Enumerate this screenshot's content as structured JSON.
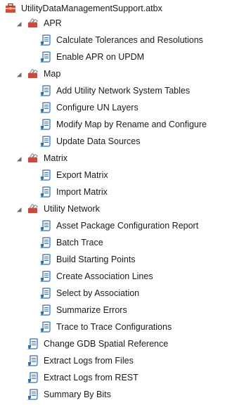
{
  "toolbox": {
    "name": "UtilityDataManagementSupport.atbx",
    "toolsets": [
      {
        "name": "APR",
        "tools": [
          "Calculate Tolerances and Resolutions",
          "Enable APR on UPDM"
        ]
      },
      {
        "name": "Map",
        "tools": [
          "Add Utility Network System Tables",
          "Configure UN Layers",
          "Modify Map by Rename and Configure",
          "Update Data Sources"
        ]
      },
      {
        "name": "Matrix",
        "tools": [
          "Export Matrix",
          "Import Matrix"
        ]
      },
      {
        "name": "Utility Network",
        "tools": [
          "Asset Package Configuration Report",
          "Batch Trace",
          "Build Starting Points",
          "Create Association Lines",
          "Select by Association",
          "Summarize Errors",
          "Trace to Trace Configurations"
        ]
      }
    ],
    "tools": [
      "Change GDB Spatial Reference",
      "Extract Logs from Files",
      "Extract Logs from REST",
      "Summary By Bits"
    ]
  },
  "icons": {
    "expand": "chevron-down-icon",
    "toolbox": "toolbox-icon",
    "toolset": "toolset-icon",
    "tool": "script-tool-icon"
  },
  "colors": {
    "toolbox_red": "#d64a3a",
    "toolset_red": "#c94a3c",
    "tool_blue": "#2e6fb5",
    "chevron": "#6a6a6a"
  }
}
